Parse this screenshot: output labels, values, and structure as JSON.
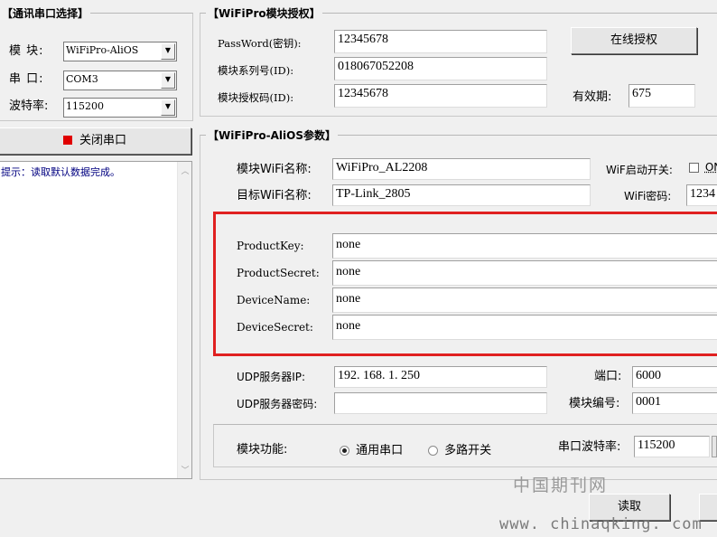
{
  "comm": {
    "title": "【通讯串口选择】",
    "module_label": "模 块:",
    "module_value": "WiFiPro-AliOS",
    "port_label": "串 口:",
    "port_value": "COM3",
    "baud_label": "波特率:",
    "baud_value": "115200",
    "close_button": "关闭串口",
    "status_color": "#e00000"
  },
  "log": {
    "text": "提示：读取默认数据完成。"
  },
  "auth": {
    "title": "【WiFiPro模块授权】",
    "password_label": "PassWord(密钥):",
    "password_value": "12345678",
    "serial_label": "模块系列号(ID):",
    "serial_value": "018067052208",
    "authcode_label": "模块授权码(ID):",
    "authcode_value": "12345678",
    "online_button": "在线授权",
    "validity_label": "有效期:",
    "validity_value": "675"
  },
  "params": {
    "title": "【WiFiPro-AliOS参数】",
    "module_wifi_label": "模块WiFi名称:",
    "module_wifi_value": "WiFiPro_AL2208",
    "wifi_switch_label": "WiF启动开关:",
    "wifi_switch_option": "ON",
    "target_wifi_label": "目标WiFi名称:",
    "target_wifi_value": "TP-Link_2805",
    "wifi_password_label": "WiFi密码:",
    "wifi_password_value": "1234",
    "product_key_label": "ProductKey:",
    "product_key_value": "none",
    "product_secret_label": "ProductSecret:",
    "product_secret_value": "none",
    "device_name_label": "DeviceName:",
    "device_name_value": "none",
    "device_secret_label": "DeviceSecret:",
    "device_secret_value": "none",
    "highlight_color": "#e02020",
    "udp_ip_label": "UDP服务器IP:",
    "udp_ip_value": "192. 168. 1. 250",
    "port_label": "端口:",
    "port_value": "6000",
    "udp_pwd_label": "UDP服务器密码:",
    "udp_pwd_value": "",
    "module_no_label": "模块编号:",
    "module_no_value": "0001",
    "function_label": "模块功能:",
    "option_serial": "通用串口",
    "option_switch": "多路开关",
    "serial_baud_label": "串口波特率:",
    "serial_baud_value": "115200"
  },
  "actions": {
    "read_button": "读取"
  },
  "watermark": {
    "cn": "中国期刊网",
    "url": "www. chinaqking. com"
  }
}
